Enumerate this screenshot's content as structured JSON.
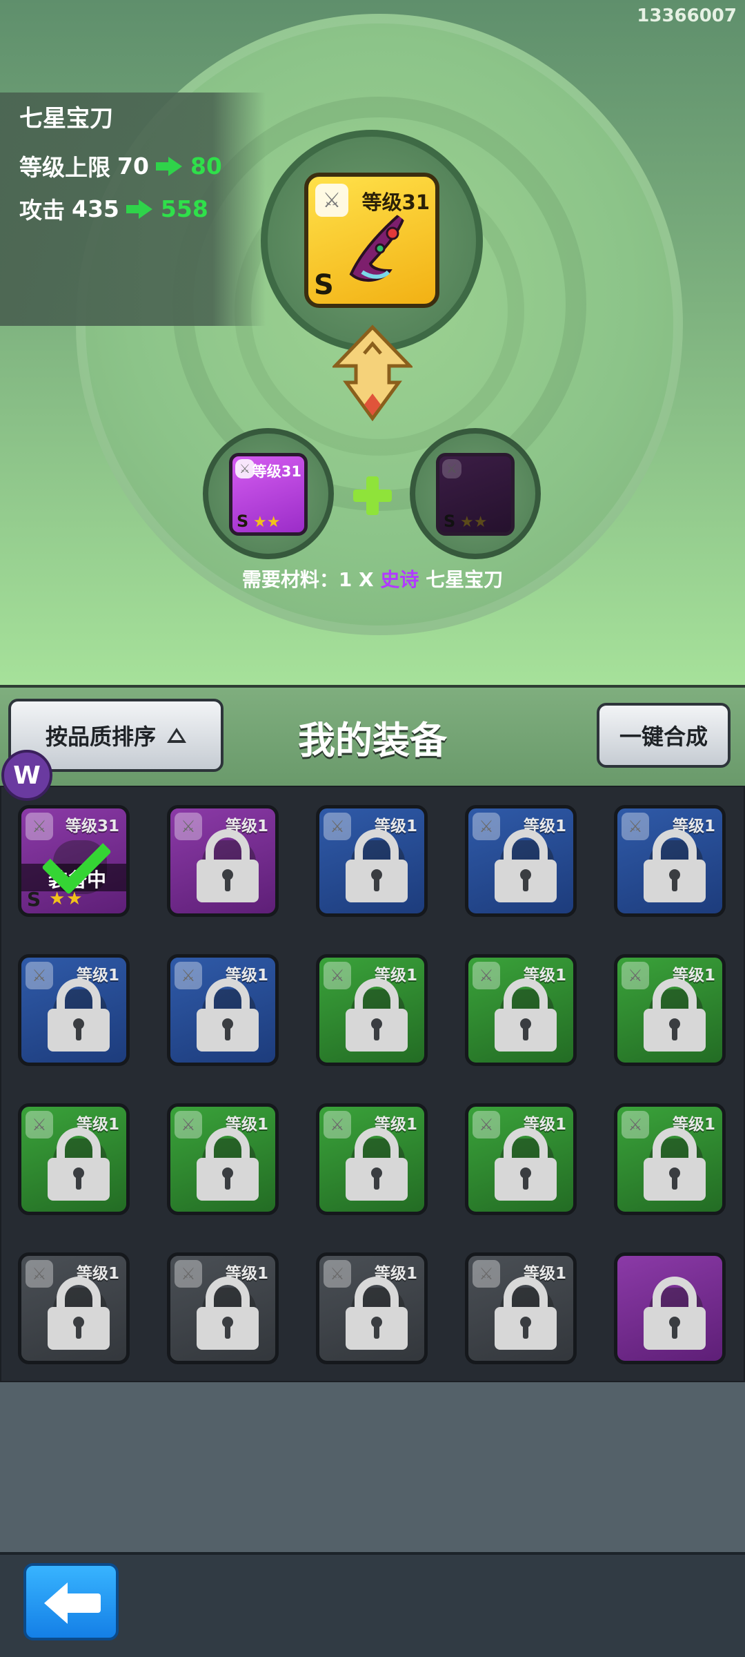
{
  "header": {
    "user_id": "13366007"
  },
  "item": {
    "name": "七星宝刀",
    "level_cap_label": "等级上限",
    "level_cap_current": "70",
    "level_cap_next": "80",
    "attack_label": "攻击",
    "attack_current": "435",
    "attack_next": "558",
    "card_level": "等级31",
    "grade": "S"
  },
  "materials": {
    "slot1_level": "等级31",
    "slot1_grade": "S",
    "slot2_grade": "S",
    "required_prefix": "需要材料：1 X",
    "required_quality": "史诗",
    "required_name": "七星宝刀"
  },
  "equipment": {
    "sort_button": "按品质排序",
    "title": "我的装备",
    "merge_button": "一键合成",
    "badge_letter": "W",
    "equipped_label": "装备中",
    "slots": [
      {
        "level": "等级31",
        "color": "purple",
        "locked": false,
        "equipped": true
      },
      {
        "level": "等级1",
        "color": "purple",
        "locked": true
      },
      {
        "level": "等级1",
        "color": "blue",
        "locked": true
      },
      {
        "level": "等级1",
        "color": "blue",
        "locked": true
      },
      {
        "level": "等级1",
        "color": "blue",
        "locked": true
      },
      {
        "level": "等级1",
        "color": "blue",
        "locked": true
      },
      {
        "level": "等级1",
        "color": "blue",
        "locked": true
      },
      {
        "level": "等级1",
        "color": "green",
        "locked": true
      },
      {
        "level": "等级1",
        "color": "green",
        "locked": true
      },
      {
        "level": "等级1",
        "color": "green",
        "locked": true
      },
      {
        "level": "等级1",
        "color": "green",
        "locked": true
      },
      {
        "level": "等级1",
        "color": "green",
        "locked": true
      },
      {
        "level": "等级1",
        "color": "green",
        "locked": true
      },
      {
        "level": "等级1",
        "color": "green",
        "locked": true
      },
      {
        "level": "等级1",
        "color": "green",
        "locked": true
      },
      {
        "level": "等级1",
        "color": "gray",
        "locked": true
      },
      {
        "level": "等级1",
        "color": "gray",
        "locked": true
      },
      {
        "level": "等级1",
        "color": "gray",
        "locked": true
      },
      {
        "level": "等级1",
        "color": "gray",
        "locked": true
      },
      {
        "level": "",
        "color": "purple",
        "locked": true
      }
    ]
  },
  "colors": {
    "accent_green": "#2fe04a",
    "epic_purple": "#b13bff",
    "back_blue": "#1e8ef0"
  }
}
